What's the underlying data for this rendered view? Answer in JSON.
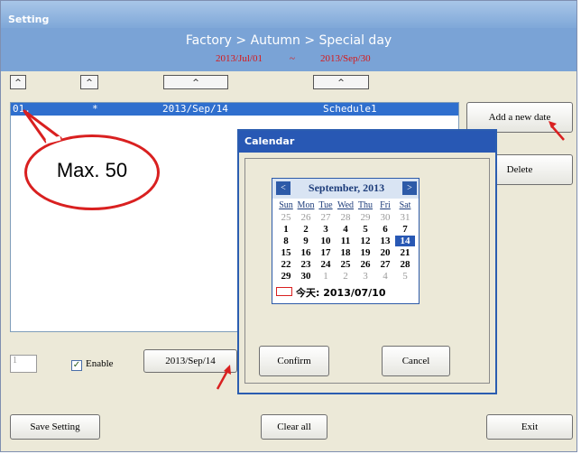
{
  "window": {
    "title": "Setting"
  },
  "header": {
    "breadcrumb": "Factory > Autumn > Special day",
    "range_start": "2013/Jul/01",
    "range_sep": "~",
    "range_end": "2013/Sep/30"
  },
  "sort_buttons": [
    "^",
    "^",
    "^",
    "^"
  ],
  "list": {
    "rows": [
      {
        "index": "01.",
        "mark": "*",
        "date": "2013/Sep/14",
        "schedule": "Schedule1"
      }
    ]
  },
  "annotation": {
    "bubble_text": "Max. 50"
  },
  "actions": {
    "add_label": "Add a new date",
    "delete_label": "Delete"
  },
  "calendar_dialog": {
    "title": "Calendar",
    "month_label": "September, 2013",
    "prev": "<",
    "next": ">",
    "weekdays": [
      "Sun",
      "Mon",
      "Tue",
      "Wed",
      "Thu",
      "Fri",
      "Sat"
    ],
    "weeks": [
      [
        "25",
        "26",
        "27",
        "28",
        "29",
        "30",
        "31"
      ],
      [
        "1",
        "2",
        "3",
        "4",
        "5",
        "6",
        "7"
      ],
      [
        "8",
        "9",
        "10",
        "11",
        "12",
        "13",
        "14"
      ],
      [
        "15",
        "16",
        "17",
        "18",
        "19",
        "20",
        "21"
      ],
      [
        "22",
        "23",
        "24",
        "25",
        "26",
        "27",
        "28"
      ],
      [
        "29",
        "30",
        "1",
        "2",
        "3",
        "4",
        "5"
      ]
    ],
    "selected_day": "14",
    "today_label": "今天: 2013/07/10",
    "confirm_label": "Confirm",
    "cancel_label": "Cancel"
  },
  "bottom": {
    "number_value": "1",
    "enable_label": "Enable",
    "enable_checked": true,
    "date_button_label": "2013/Sep/14"
  },
  "footer": {
    "save_label": "Save Setting",
    "clear_label": "Clear all",
    "exit_label": "Exit"
  },
  "colors": {
    "accent": "#2858b4",
    "annotation": "#d92020",
    "header_band": "#7aa3d6"
  }
}
